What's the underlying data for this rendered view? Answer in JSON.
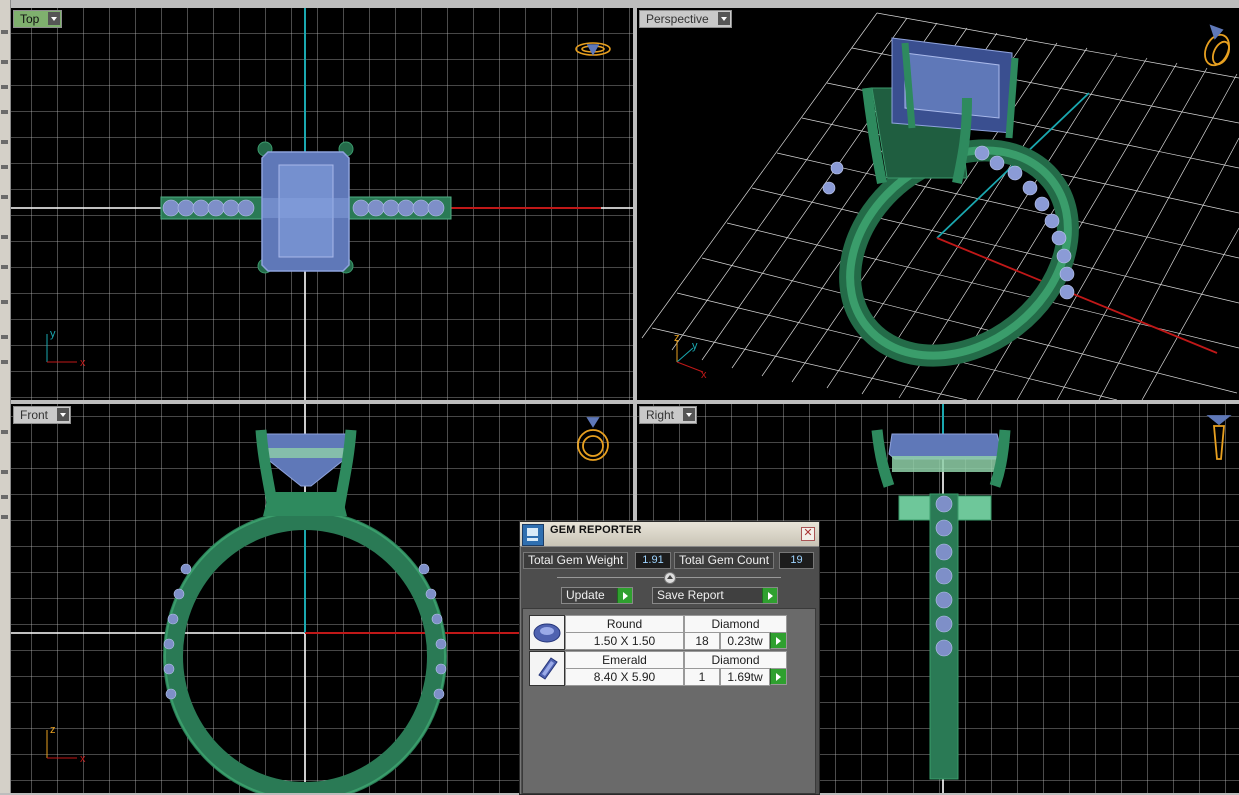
{
  "viewports": {
    "top": {
      "label": "Top"
    },
    "perspective": {
      "label": "Perspective"
    },
    "front": {
      "label": "Front"
    },
    "right": {
      "label": "Right"
    }
  },
  "axes": {
    "x": "x",
    "y": "y",
    "z": "z"
  },
  "gem_reporter": {
    "title": "GEM REPORTER",
    "close": "✕",
    "total_weight_label": "Total Gem Weight",
    "total_weight_value": "1.91",
    "total_count_label": "Total Gem Count",
    "total_count_value": "19",
    "update_label": "Update",
    "save_label": "Save Report",
    "gems": [
      {
        "shape": "Round",
        "material": "Diamond",
        "size": "1.50 X 1.50",
        "count": "18",
        "weight": "0.23tw",
        "icon": "round-gem-icon"
      },
      {
        "shape": "Emerald",
        "material": "Diamond",
        "size": "8.40 X 5.90",
        "count": "1",
        "weight": "1.69tw",
        "icon": "emerald-gem-icon"
      }
    ]
  },
  "colors": {
    "metal": "#2e8a5e",
    "gem": "#5f78b8",
    "x_axis": "#c01818",
    "y_axis": "#1aa8b0",
    "grid": "#c8c8c8",
    "viewport_bg": "#000000",
    "active_label": "#7fb06e"
  }
}
